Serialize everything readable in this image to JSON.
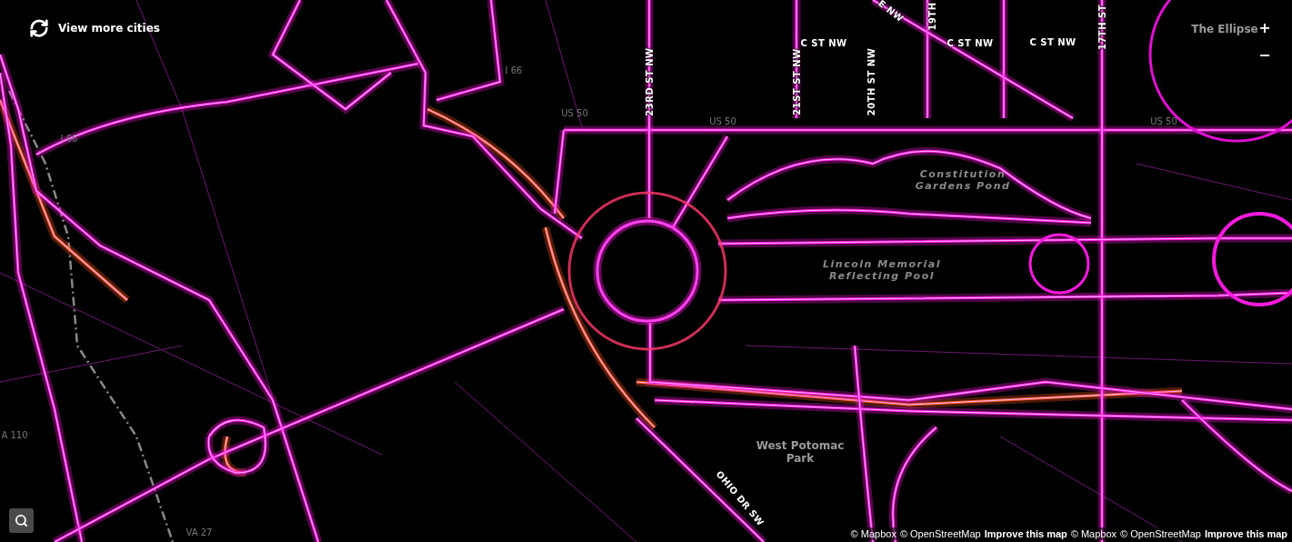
{
  "city_switcher": {
    "label": "View more cities"
  },
  "zoom_controls": {
    "zoom_in": "+",
    "zoom_out": "−"
  },
  "map": {
    "labels": [
      {
        "kind": "shield",
        "text": "I 66"
      },
      {
        "kind": "shield",
        "text": "I 66"
      },
      {
        "kind": "shield",
        "text": "US 50"
      },
      {
        "kind": "shield",
        "text": "US 50"
      },
      {
        "kind": "shield",
        "text": "US 50"
      },
      {
        "kind": "shield",
        "text": "A 110"
      },
      {
        "kind": "shield",
        "text": "VA 27"
      },
      {
        "kind": "street",
        "text": "23RD ST NW"
      },
      {
        "kind": "street",
        "text": "21ST ST NW"
      },
      {
        "kind": "street",
        "text": "20TH ST NW"
      },
      {
        "kind": "street",
        "text": "19TH"
      },
      {
        "kind": "street",
        "text": "17TH ST"
      },
      {
        "kind": "street",
        "text": "E NW"
      },
      {
        "kind": "street",
        "text": "C ST NW"
      },
      {
        "kind": "street",
        "text": "C ST NW"
      },
      {
        "kind": "street",
        "text": "C ST NW"
      },
      {
        "kind": "place",
        "text": "The Ellipse"
      },
      {
        "kind": "water",
        "text": "Constitution Gardens Pond"
      },
      {
        "kind": "water",
        "text": "Lincoln Memorial Reflecting Pool"
      },
      {
        "kind": "place",
        "text": "West Potomac Park"
      },
      {
        "kind": "street",
        "text": "OHIO DR SW"
      }
    ]
  },
  "attribution": [
    {
      "kind": "credit",
      "text": "© Mapbox"
    },
    {
      "kind": "credit",
      "text": "© OpenStreetMap"
    },
    {
      "kind": "link",
      "text": "Improve this map"
    },
    {
      "kind": "credit",
      "text": "© Mapbox"
    },
    {
      "kind": "credit",
      "text": "© OpenStreetMap"
    },
    {
      "kind": "link",
      "text": "Improve this map"
    }
  ]
}
